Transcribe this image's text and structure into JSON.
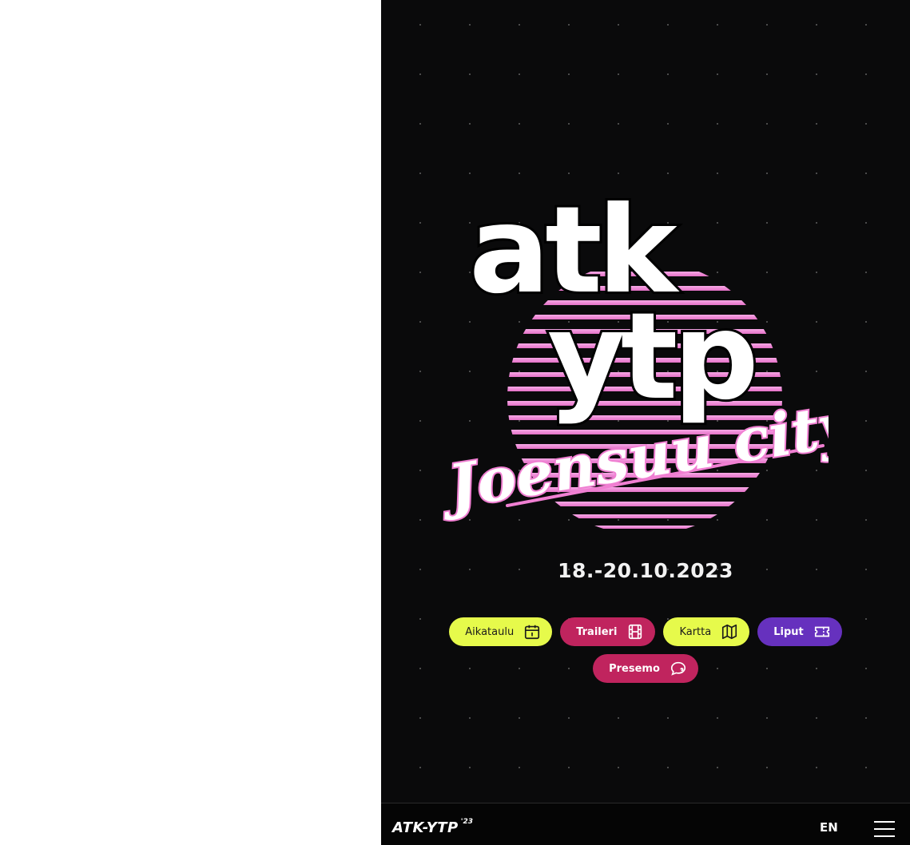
{
  "hero": {
    "logo_text": [
      "atk",
      "ytp"
    ],
    "script_text": "Joensuu city",
    "dates": "18.-20.10.2023"
  },
  "actions": [
    {
      "label": "Aikataulu",
      "icon": "calendar-icon",
      "color": "#e6fa4b"
    },
    {
      "label": "Traileri",
      "icon": "film-icon",
      "color": "#c0245e"
    },
    {
      "label": "Kartta",
      "icon": "map-icon",
      "color": "#e6fa4b"
    },
    {
      "label": "Liput",
      "icon": "ticket-icon",
      "color": "#6631be"
    },
    {
      "label": "Presemo",
      "icon": "chat-question-icon",
      "color": "#c0245e"
    }
  ],
  "bottom_bar": {
    "brand_name": "ATK-YTP",
    "brand_year": "'23",
    "language": "EN",
    "menu_icon": "hamburger-icon"
  },
  "colors": {
    "background": "#0a0a0b",
    "lime": "#e6fa4b",
    "magenta": "#c0245e",
    "purple": "#6631be",
    "pink": "#f07fd2"
  }
}
